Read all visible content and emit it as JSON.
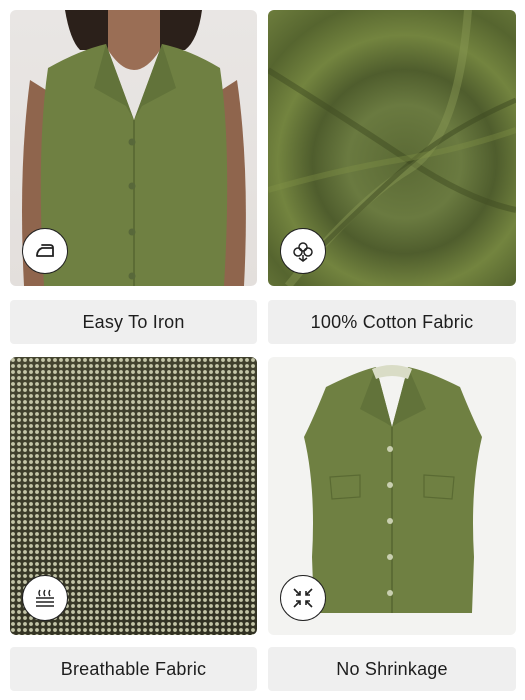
{
  "features": [
    {
      "label": "Easy To Iron",
      "icon": "iron-icon"
    },
    {
      "label": "100% Cotton Fabric",
      "icon": "cotton-icon"
    },
    {
      "label": "Breathable Fabric",
      "icon": "breathable-icon"
    },
    {
      "label": "No Shrinkage",
      "icon": "no-shrinkage-icon"
    }
  ],
  "colors": {
    "shirt": "#6f8042",
    "label_bg": "#efefef"
  }
}
